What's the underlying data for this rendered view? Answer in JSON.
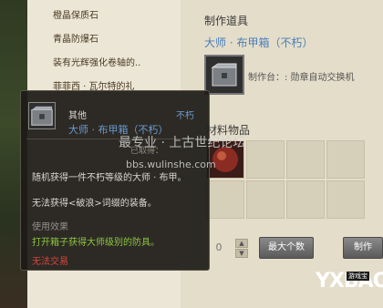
{
  "recipe_list": {
    "items": [
      {
        "label": "橙晶保质石"
      },
      {
        "label": "青晶防爆石"
      },
      {
        "label": "装有光辉强化卷轴的.."
      },
      {
        "label": "菲菲西 · 瓦尔特的礼"
      }
    ]
  },
  "craft_panel": {
    "tool_title": "制作道具",
    "item_name": "大师 · 布甲箱（不朽）",
    "workbench_label": "制作台：: 勋章自动交换机",
    "materials_title": "材料物品",
    "quantity": "0",
    "max_button": "最大个数",
    "craft_button": "制作"
  },
  "tooltip": {
    "category": "其他",
    "rarity": "不朽",
    "item_name": "大师 · 布甲箱（不朽）",
    "status_obscured": "已取得：",
    "description": "随机获得一件不朽等级的大师 · 布甲。",
    "restriction": "无法获得<破浪>词缀的装备。",
    "use_effect_label": "使用效果",
    "use_effect_text": "打开箱子获得大师级别的防具。",
    "no_trade": "无法交易"
  },
  "watermark": {
    "line1": "最专业 · 上古世纪论坛",
    "line2": "bbs.wulinshe.com"
  },
  "logo": {
    "text": "YXBAO",
    "sub": "游戏宝"
  },
  "colors": {
    "item_blue": "#4a7fb8",
    "use_effect_green": "#8dc63f",
    "no_trade_red": "#d9443a"
  }
}
